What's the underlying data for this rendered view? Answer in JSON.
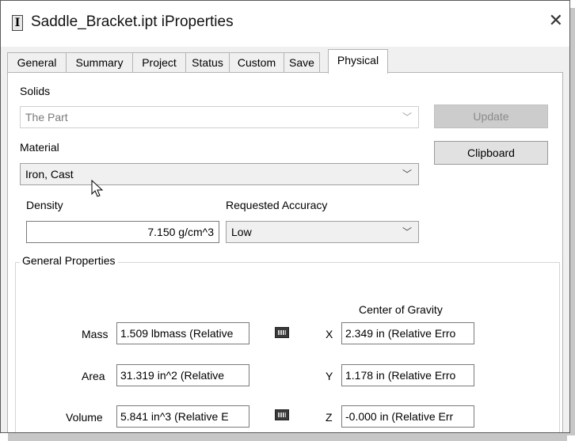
{
  "window": {
    "title": "Saddle_Bracket.ipt iProperties"
  },
  "tabs": [
    {
      "label": "General"
    },
    {
      "label": "Summary"
    },
    {
      "label": "Project"
    },
    {
      "label": "Status"
    },
    {
      "label": "Custom"
    },
    {
      "label": "Save"
    },
    {
      "label": "Physical",
      "active": true
    }
  ],
  "physical": {
    "solids_label": "Solids",
    "solids_value": "The Part",
    "update_button": "Update",
    "material_label": "Material",
    "material_value": "Iron, Cast",
    "clipboard_button": "Clipboard",
    "density_label": "Density",
    "density_value": "7.150 g/cm^3",
    "accuracy_label": "Requested Accuracy",
    "accuracy_value": "Low",
    "general_properties": "General Properties",
    "center_of_gravity": "Center of Gravity",
    "mass_label": "Mass",
    "mass_value": "1.509 lbmass (Relative",
    "area_label": "Area",
    "area_value": "31.319 in^2 (Relative",
    "volume_label": "Volume",
    "volume_value": "5.841 in^3 (Relative E",
    "x_label": "X",
    "x_value": "2.349 in (Relative Erro",
    "y_label": "Y",
    "y_value": "1.178 in (Relative Erro",
    "z_label": "Z",
    "z_value": "-0.000 in (Relative Err"
  },
  "icons": {
    "app": "inventor-app-icon",
    "close": "close-icon",
    "dropdown": "chevron-down-icon",
    "calculator": "calculator-icon",
    "cursor": "mouse-pointer-icon"
  }
}
